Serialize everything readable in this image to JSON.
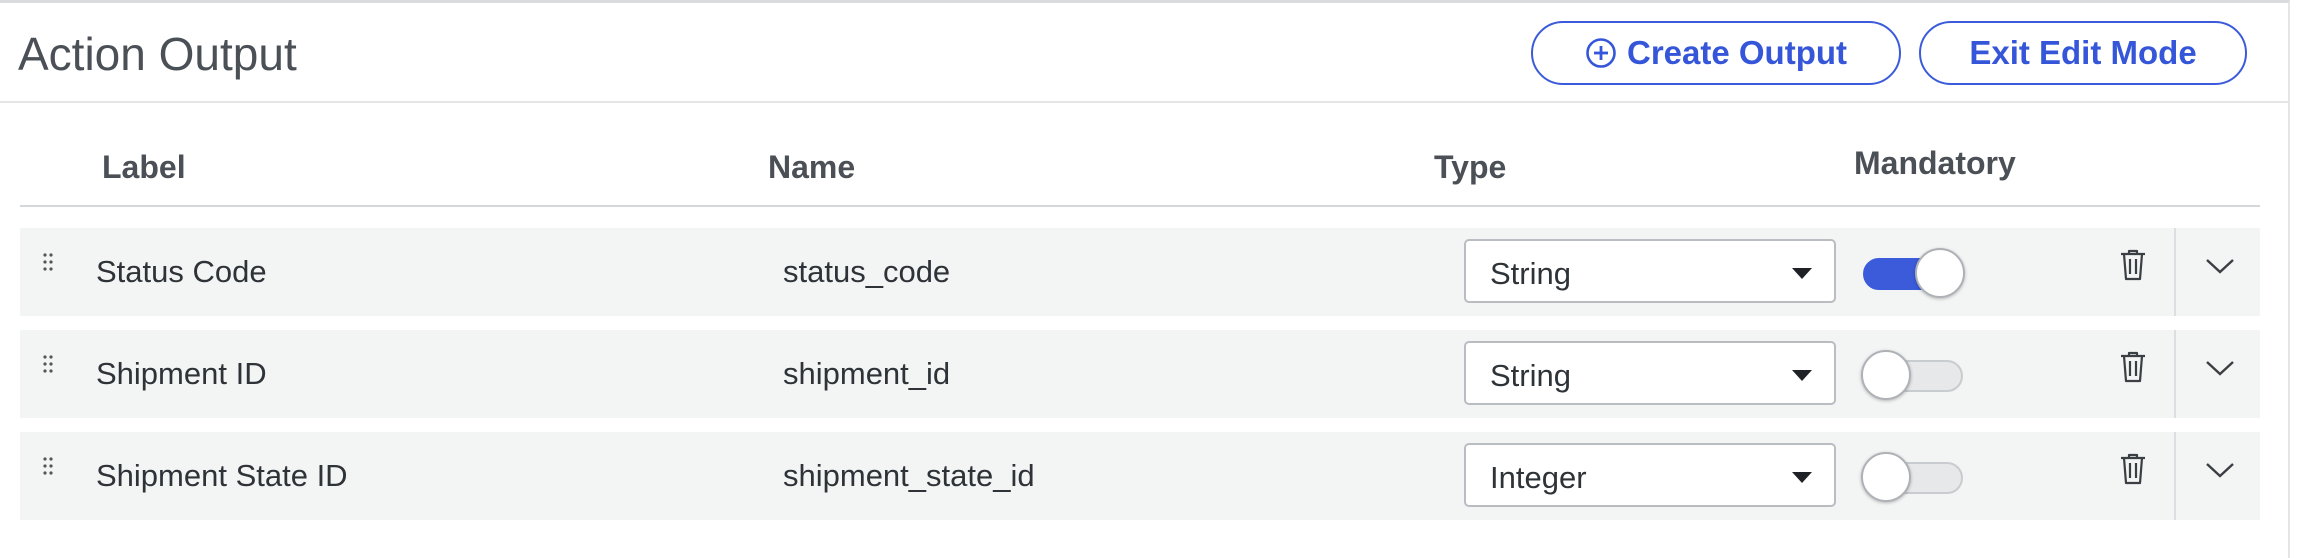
{
  "panel": {
    "title": "Action Output",
    "create_button": {
      "label": "Create Output",
      "icon": "plus-circle-icon"
    },
    "exit_button": {
      "label": "Exit Edit Mode"
    }
  },
  "columns": {
    "label": "Label",
    "name": "Name",
    "type": "Type",
    "mandatory": "Mandatory"
  },
  "rows": [
    {
      "label": "Status Code",
      "name": "status_code",
      "type": "String",
      "mandatory": true
    },
    {
      "label": "Shipment ID",
      "name": "shipment_id",
      "type": "String",
      "mandatory": false
    },
    {
      "label": "Shipment State ID",
      "name": "shipment_state_id",
      "type": "Integer",
      "mandatory": false
    }
  ],
  "colors": {
    "accent": "#3b5bdb",
    "row_background": "#f3f4f4",
    "text": "#2e3338"
  }
}
